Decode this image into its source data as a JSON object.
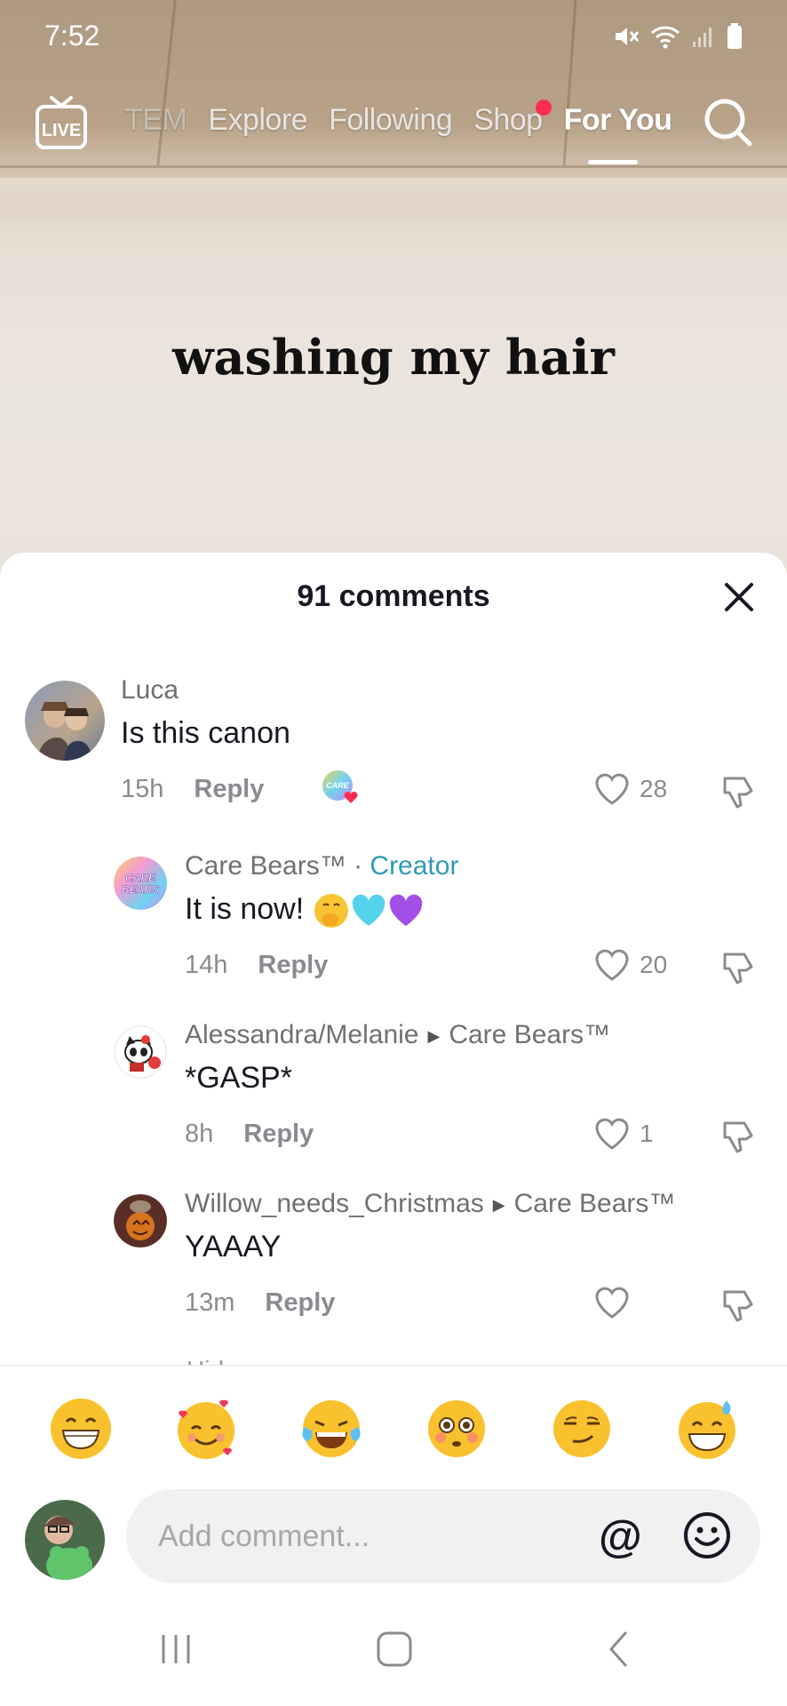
{
  "status_bar": {
    "time": "7:52"
  },
  "top_nav": {
    "live_label": "LIVE",
    "tabs": [
      {
        "label": "TEM"
      },
      {
        "label": "Explore"
      },
      {
        "label": "Following"
      },
      {
        "label": "Shop"
      },
      {
        "label": "For You"
      }
    ],
    "active_tab": "For You"
  },
  "video": {
    "caption": "washing my hair"
  },
  "comments_sheet": {
    "header": "91 comments",
    "comments": [
      {
        "user": "Luca",
        "text": "Is this canon",
        "time": "15h",
        "reply_label": "Reply",
        "likes": "28"
      },
      {
        "user": "Care Bears™",
        "separator": " · ",
        "creator_label": "Creator",
        "text": "It is now! ",
        "time": "14h",
        "reply_label": "Reply",
        "likes": "20"
      },
      {
        "user": "Alessandra/Melanie",
        "reply_to": "Care Bears™",
        "text": "*GASP*",
        "time": "8h",
        "reply_label": "Reply",
        "likes": "1"
      },
      {
        "user": "Willow_needs_Christmas",
        "reply_to": "Care Bears™",
        "text": "YAAAY",
        "time": "13m",
        "reply_label": "Reply",
        "likes": ""
      }
    ],
    "more_hint": "Hide"
  },
  "emoji_bar": {
    "emojis": [
      "grinning",
      "smiling-hearts",
      "tears-of-joy",
      "flushed",
      "smirk",
      "sweat-smile"
    ]
  },
  "composer": {
    "placeholder": "Add comment...",
    "at_symbol": "@"
  },
  "colors": {
    "creator_accent": "#2c9bb5",
    "notification_dot": "#fe2c55",
    "text_primary": "#161823",
    "text_secondary": "#8a8b91"
  }
}
